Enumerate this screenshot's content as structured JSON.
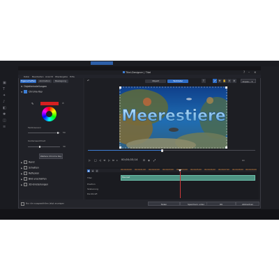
{
  "dialog": {
    "title": "Titel-Designer | Titel",
    "menu": [
      "Datei",
      "Bearbeiten",
      "Ansicht",
      "Wiedergabe",
      "Hilfe"
    ]
  },
  "left_panel": {
    "tabs": [
      "Eigenschaften",
      "Animation",
      "Bewegung"
    ],
    "sections": {
      "objekt": "Objekteinstellungen",
      "chroma": "Chroma Key",
      "rand": "Rand",
      "schatten": "Schatten",
      "reflexion": "Reflexion",
      "unschaerfe": "Bild unschärfen",
      "dreid": "3D-Einstellungen"
    },
    "labels": {
      "toleranz": "Farbtoleranz",
      "kantenabgabe": "Kantenweichheit"
    },
    "values": {
      "toleranz": "50",
      "kanten": "30"
    },
    "reset_button": "Weitere Chroma Key",
    "footer": "Nur die ausgewählten Jetzt anzeigen",
    "swatch_color": "#d52020"
  },
  "main": {
    "modes": [
      "Objekt",
      "Textdatei"
    ],
    "zoom": "Anpas...",
    "preview_title": "Meerestiere",
    "timecode": "00;00;03;14",
    "timeline": {
      "ticks": [
        "00;00;00;00",
        "00;00;01;00",
        "00;00;02;00",
        "00;00;03;00",
        "00;00;04;00",
        "00;00;05;00",
        "00;00;06;00",
        "00;00;07;00",
        "00;00;08;00",
        "00;00;09;00"
      ],
      "tracks": [
        "Titel",
        "Position",
        "Skalierung",
        "Deckkraft"
      ],
      "clip_label": "Meerest"
    }
  },
  "footer_buttons": [
    "Teilen",
    "Speichern unter",
    "OK",
    "Abbrechen"
  ],
  "colors": {
    "accent": "#2f6dc6",
    "clip": "#4e9383",
    "playhead": "#d03a3a"
  }
}
